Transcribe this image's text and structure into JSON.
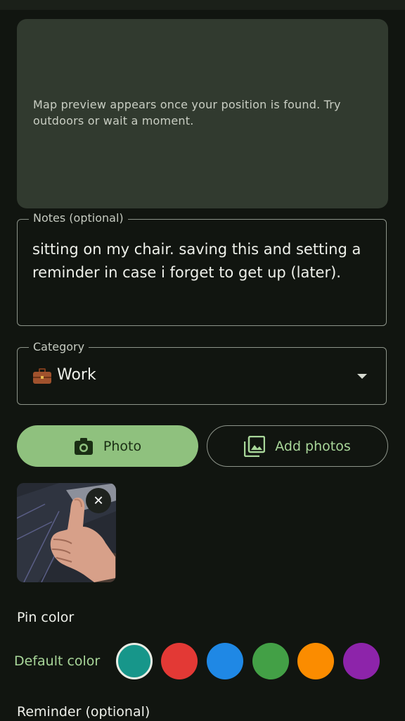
{
  "map": {
    "placeholder_text": "Map preview appears once your position is found. Try outdoors or wait a moment."
  },
  "notes": {
    "label": "Notes (optional)",
    "value": "sitting on my chair. saving this and setting a reminder in case i forget to get up (later)."
  },
  "category": {
    "label": "Category",
    "icon": "briefcase-icon",
    "value": "Work"
  },
  "buttons": {
    "photo": {
      "label": "Photo",
      "icon": "camera-icon"
    },
    "add_photos": {
      "label": "Add photos",
      "icon": "gallery-icon"
    }
  },
  "attachment": {
    "description_icon": "thumbs-up-photo",
    "remove_label": "✕"
  },
  "pin_color": {
    "title": "Pin color",
    "default_label": "Default color",
    "colors": [
      "#17968a",
      "#e33935",
      "#1f88e5",
      "#43a046",
      "#fb8c00",
      "#8d24aa"
    ],
    "selected_index": 0
  },
  "reminder": {
    "title": "Reminder (optional)"
  }
}
